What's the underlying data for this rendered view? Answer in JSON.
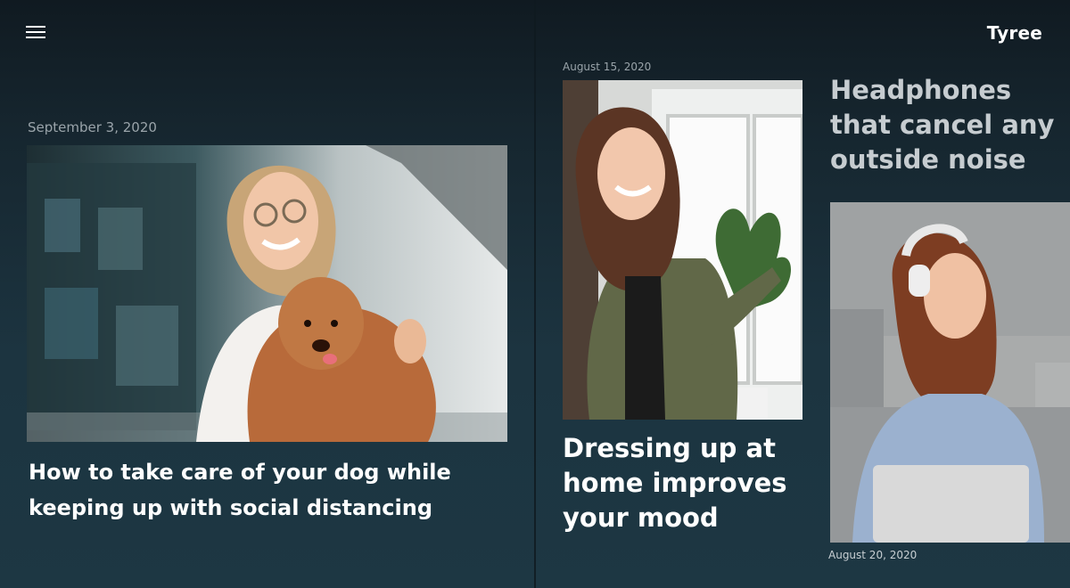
{
  "header": {
    "brand": "Tyree",
    "menu_icon": "hamburger-menu-icon"
  },
  "articles": [
    {
      "date": "September 3, 2020",
      "title": "How to take care of your dog while keeping up with social distancing",
      "image": "woman-holding-dog-photo"
    },
    {
      "date": "August 15, 2020",
      "title": "Dressing up at home improves your mood",
      "image": "smiling-woman-indoors-photo"
    },
    {
      "date": "August 20, 2020",
      "title": "Headphones that cancel any outside noise",
      "image": "woman-with-headphones-photo"
    }
  ]
}
